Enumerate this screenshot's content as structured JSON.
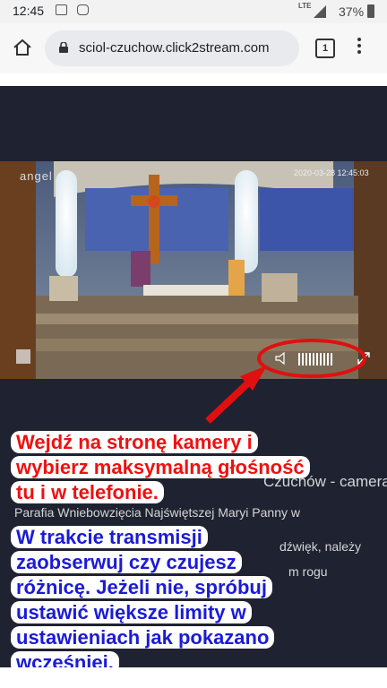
{
  "status_bar": {
    "time": "12:45",
    "network": "LTE",
    "battery": "37%"
  },
  "browser": {
    "url": "sciol-czuchow.click2stream.com",
    "tab_count": "1"
  },
  "player": {
    "brand": "angel",
    "timestamp": "2020-03-28 12:45:03",
    "volume_segments": 10
  },
  "page_text": {
    "title_fragment": "Czuchów - camera",
    "description_line": "Parafia Wniebowzięcia Najświętszej Maryi Panny w",
    "sound_fragment": "dźwięk, należy",
    "corner_fragment": "m rogu"
  },
  "annotation": {
    "red_lines": [
      "Wejdź na stronę kamery i",
      "wybierz maksymalną głośność",
      "tu i w telefonie."
    ],
    "blue_lines": [
      "W trakcie transmisji",
      "zaobserwuj czy czujesz",
      "różnicę. Jeżeli nie, spróbuj",
      "ustawić większe limity w",
      "ustawieniach jak pokazano",
      "wcześniej."
    ]
  },
  "colors": {
    "annotation_red": "#ee1111",
    "annotation_blue": "#1b1bd6",
    "page_bg": "#1f2230"
  }
}
